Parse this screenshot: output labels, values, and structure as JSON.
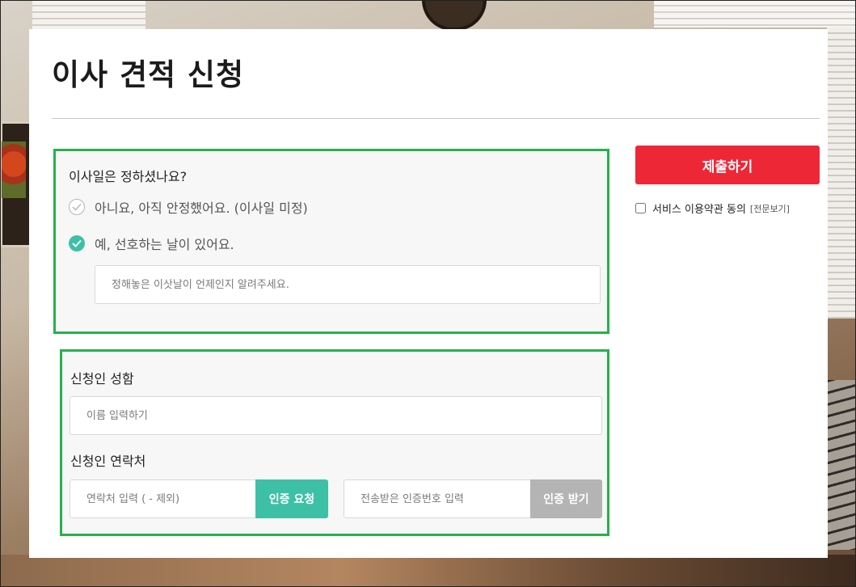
{
  "page": {
    "title": "이사 견적 신청"
  },
  "move_date": {
    "question": "이사일은 정하셨나요?",
    "options": [
      {
        "label": "아니요, 아직 안정했어요. (이사일 미정)",
        "checked": false
      },
      {
        "label": "예, 선호하는 날이 있어요.",
        "checked": true
      }
    ],
    "date_placeholder": "정해놓은 이삿날이 언제인지 알려주세요."
  },
  "applicant": {
    "name_label": "신청인 성함",
    "name_placeholder": "이름 입력하기",
    "contact_label": "신청인 연락처",
    "phone_placeholder": "연락처 입력 ( - 제외)",
    "request_code_label": "인증 요청",
    "code_placeholder": "전송받은 인증번호 입력",
    "get_code_label": "인증 받기"
  },
  "sidebar": {
    "submit_label": "제출하기",
    "terms_label": "서비스 이용약관 동의",
    "terms_view_label": "[전문보기]"
  },
  "colors": {
    "accent_green": "#3ec0a6",
    "submit_red": "#ee2737",
    "highlight_border": "#27b14b",
    "disabled_gray": "#b4b4b4"
  },
  "icons": [
    "check-circle-empty-icon",
    "check-circle-filled-icon"
  ]
}
